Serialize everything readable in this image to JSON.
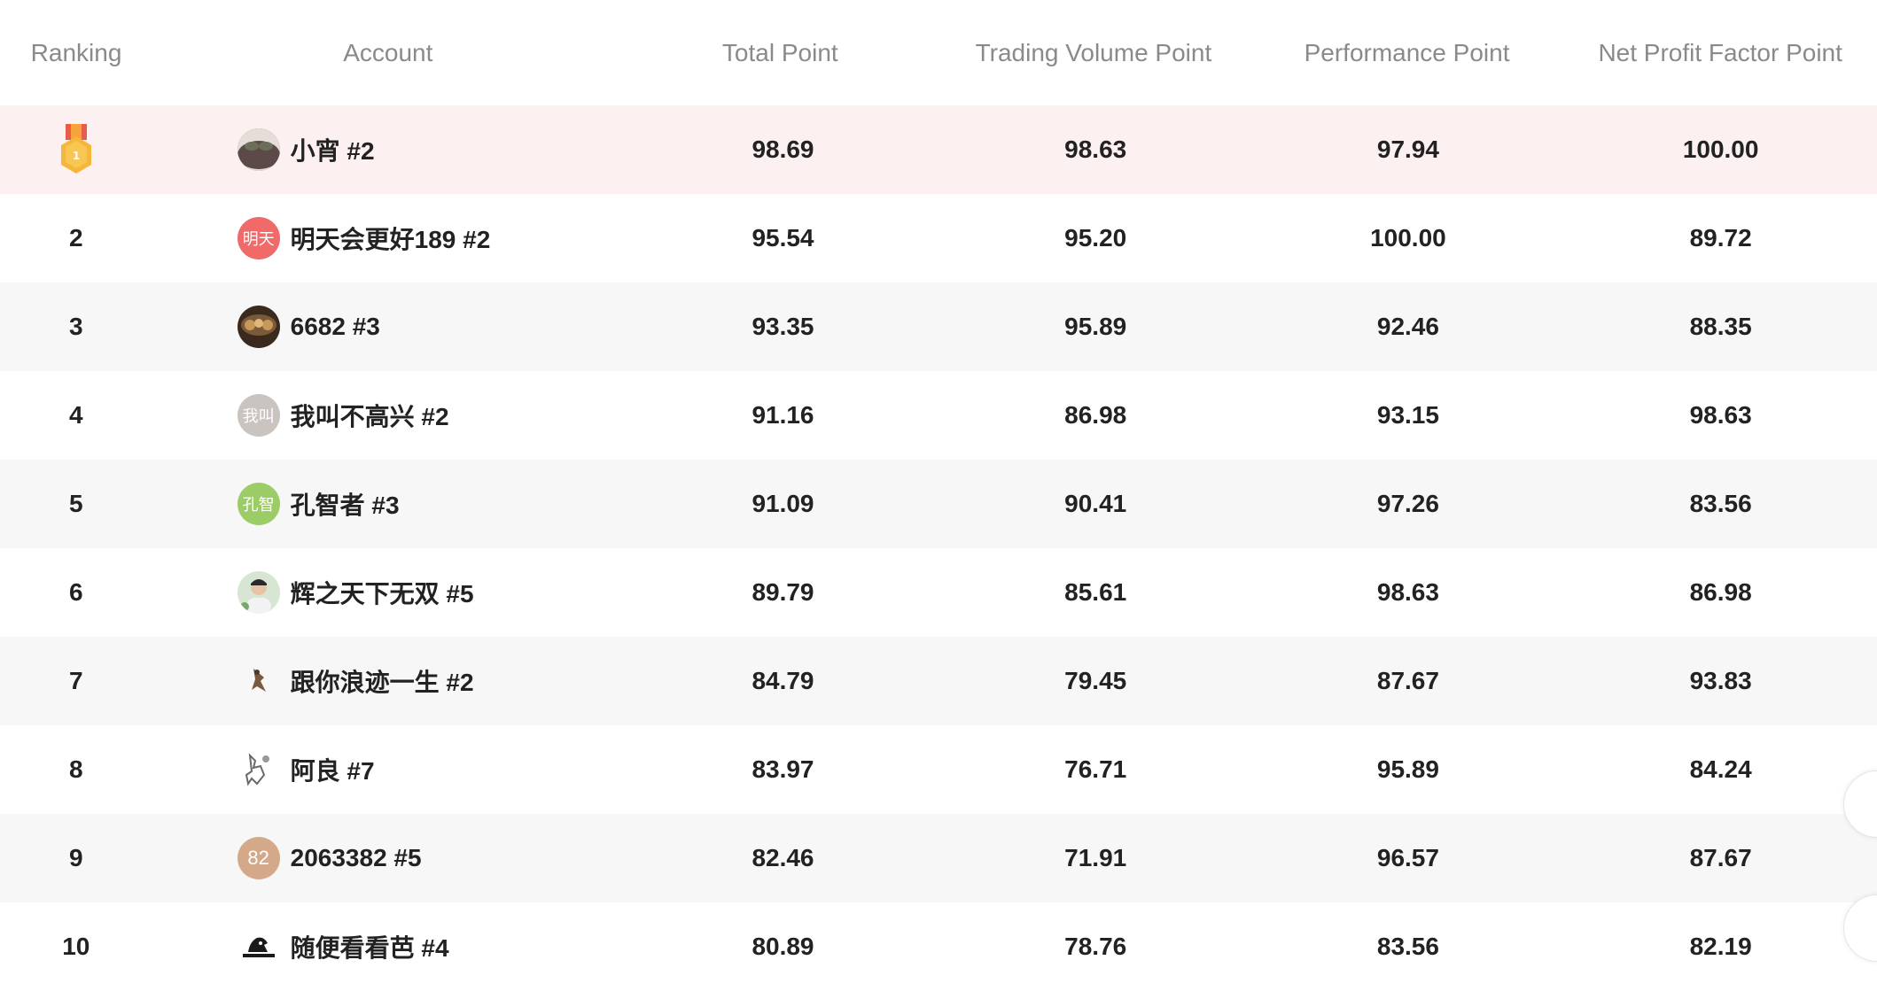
{
  "header": {
    "ranking": "Ranking",
    "account": "Account",
    "total_point": "Total Point",
    "trading_volume_point": "Trading Volume Point",
    "performance_point": "Performance Point",
    "net_profit_factor_point": "Net Profit Factor Point"
  },
  "rows": [
    {
      "rank": "1",
      "account": "小宵 #2",
      "avatar_text": "",
      "total": "98.69",
      "volume": "98.63",
      "performance": "97.94",
      "npf": "100.00"
    },
    {
      "rank": "2",
      "account": "明天会更好189 #2",
      "avatar_text": "明天",
      "total": "95.54",
      "volume": "95.20",
      "performance": "100.00",
      "npf": "89.72"
    },
    {
      "rank": "3",
      "account": "6682 #3",
      "avatar_text": "",
      "total": "93.35",
      "volume": "95.89",
      "performance": "92.46",
      "npf": "88.35"
    },
    {
      "rank": "4",
      "account": "我叫不高兴 #2",
      "avatar_text": "我叫",
      "total": "91.16",
      "volume": "86.98",
      "performance": "93.15",
      "npf": "98.63"
    },
    {
      "rank": "5",
      "account": "孔智者 #3",
      "avatar_text": "孔智",
      "total": "91.09",
      "volume": "90.41",
      "performance": "97.26",
      "npf": "83.56"
    },
    {
      "rank": "6",
      "account": "辉之天下无双 #5",
      "avatar_text": "",
      "total": "89.79",
      "volume": "85.61",
      "performance": "98.63",
      "npf": "86.98"
    },
    {
      "rank": "7",
      "account": "跟你浪迹一生 #2",
      "avatar_text": "",
      "total": "84.79",
      "volume": "79.45",
      "performance": "87.67",
      "npf": "93.83"
    },
    {
      "rank": "8",
      "account": "阿良 #7",
      "avatar_text": "",
      "total": "83.97",
      "volume": "76.71",
      "performance": "95.89",
      "npf": "84.24"
    },
    {
      "rank": "9",
      "account": "2063382 #5",
      "avatar_text": "82",
      "total": "82.46",
      "volume": "71.91",
      "performance": "96.57",
      "npf": "87.67"
    },
    {
      "rank": "10",
      "account": "随便看看芭 #4",
      "avatar_text": "",
      "total": "80.89",
      "volume": "78.76",
      "performance": "83.56",
      "npf": "82.19"
    }
  ],
  "colors": {
    "highlight_row": "#fdf0f0",
    "stripe_row": "#f7f7f7",
    "header_text": "#8a8a8a",
    "medal_gold": "#f5b73a",
    "avatar_ming": "#f06a6a",
    "avatar_wo": "#c9c4bf",
    "avatar_kong": "#9ccc65",
    "avatar_82": "#d4a98a"
  },
  "icons": {
    "rank_1": "gold-medal-icon"
  }
}
